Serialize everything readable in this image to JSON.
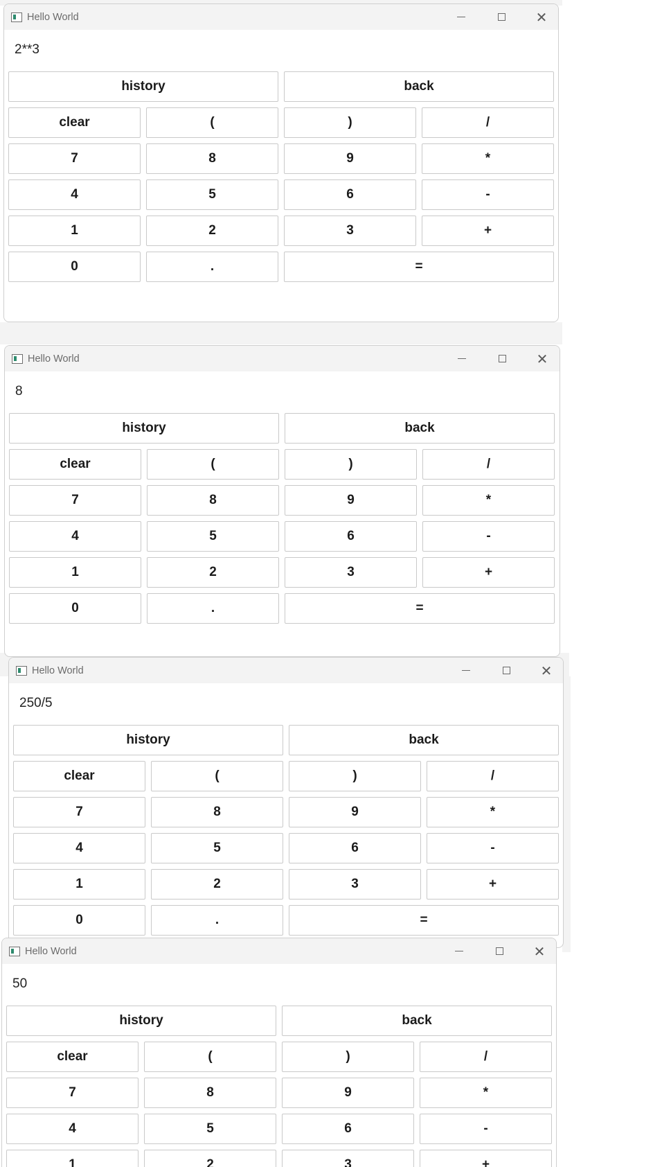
{
  "windows": [
    {
      "title": "Hello World",
      "display": "2**3"
    },
    {
      "title": "Hello World",
      "display": "8"
    },
    {
      "title": "Hello World",
      "display": "250/5"
    },
    {
      "title": "Hello World",
      "display": "50"
    }
  ],
  "buttons": {
    "history": "history",
    "back": "back",
    "clear": "clear",
    "lparen": "(",
    "rparen": ")",
    "divide": "/",
    "seven": "7",
    "eight": "8",
    "nine": "9",
    "multiply": "*",
    "four": "4",
    "five": "5",
    "six": "6",
    "minus": "-",
    "one": "1",
    "two": "2",
    "three": "3",
    "plus": "+",
    "zero": "0",
    "dot": ".",
    "equals": "="
  },
  "icons": {
    "app": "app-window-icon",
    "minimize": "minimize-icon",
    "maximize": "maximize-icon",
    "close": "close-icon"
  }
}
